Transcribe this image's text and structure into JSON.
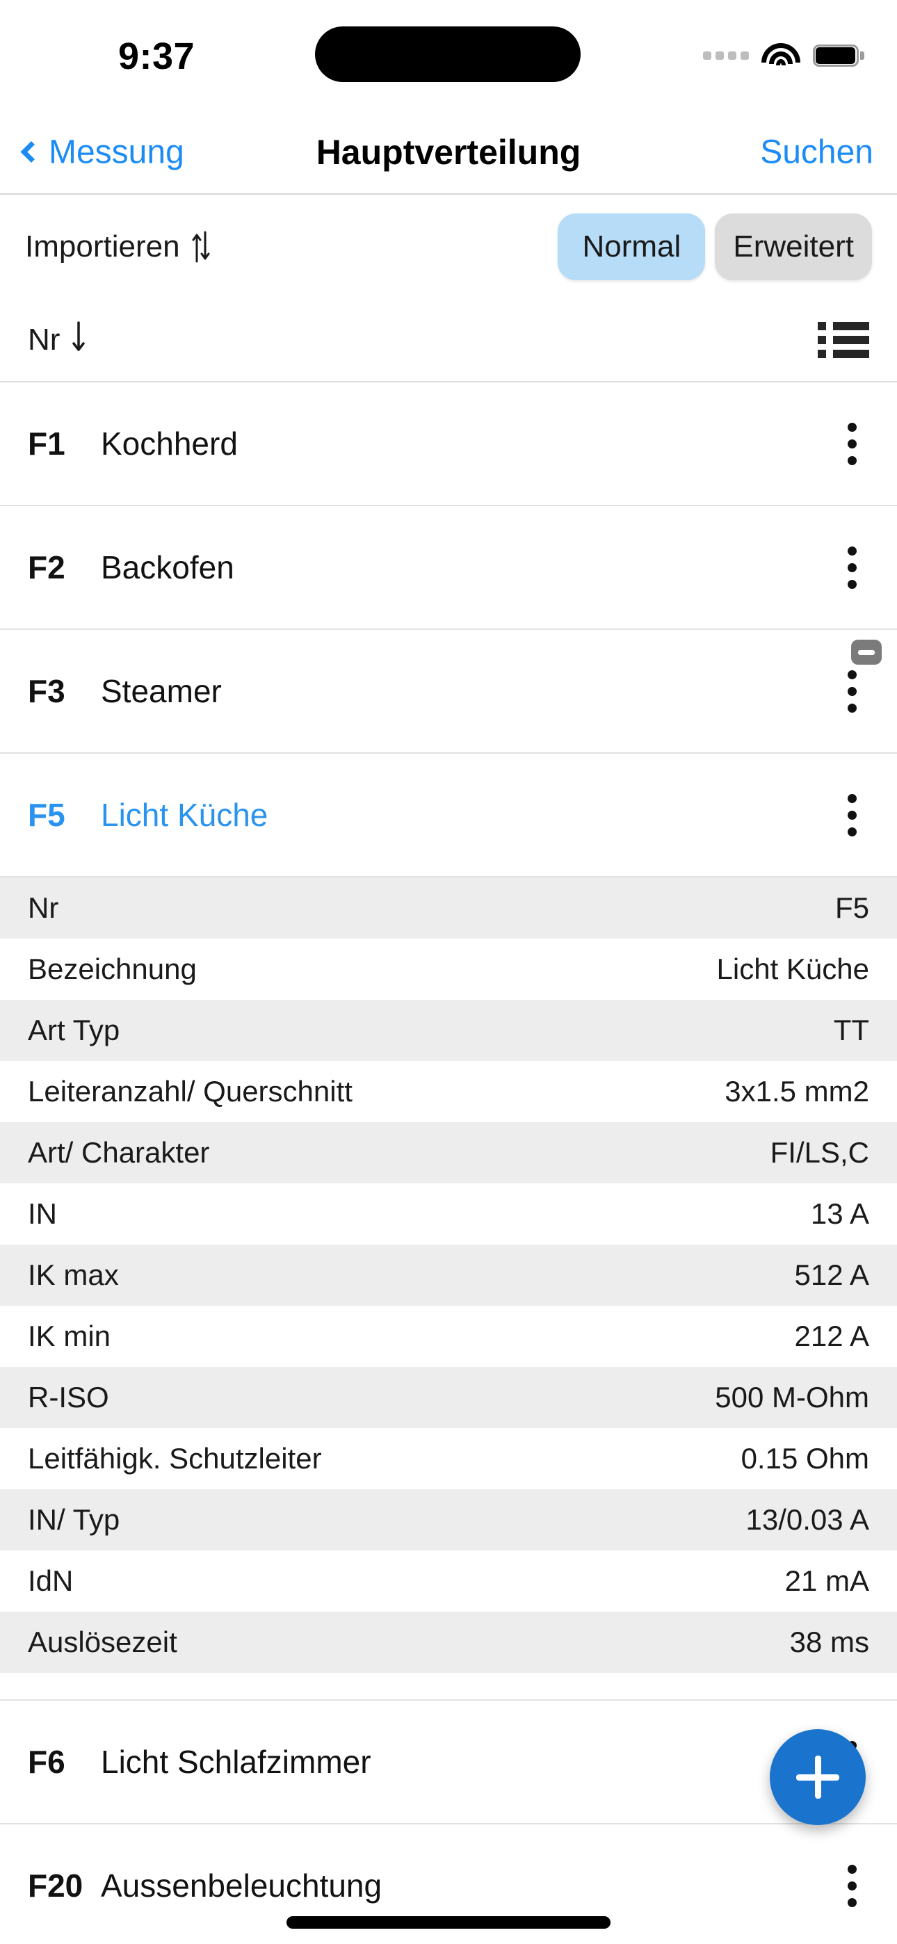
{
  "status_bar": {
    "time": "9:37",
    "icons": [
      "cellular-dots-icon",
      "wifi-icon",
      "battery-icon"
    ]
  },
  "nav_bar": {
    "back_label": "Messung",
    "back_icon": "chevron-left-icon",
    "title": "Hauptverteilung",
    "action_label": "Suchen"
  },
  "toolbar": {
    "import_label": "Importieren",
    "import_icon": "arrows-up-down-icon",
    "segments": [
      {
        "label": "Normal",
        "selected": true
      },
      {
        "label": "Erweitert",
        "selected": false
      }
    ]
  },
  "sort_bar": {
    "label": "Nr",
    "direction_icon": "arrow-down-icon",
    "list_view_icon": "list-bullet-icon"
  },
  "list": {
    "rows": [
      {
        "code": "F1",
        "name": "Kochherd",
        "selected": false,
        "has_minus_badge": false
      },
      {
        "code": "F2",
        "name": "Backofen",
        "selected": false,
        "has_minus_badge": false
      },
      {
        "code": "F3",
        "name": "Steamer",
        "selected": false,
        "has_minus_badge": true
      },
      {
        "code": "F5",
        "name": "Licht Küche",
        "selected": true,
        "has_minus_badge": false
      },
      {
        "code": "F6",
        "name": "Licht Schlafzimmer",
        "selected": false,
        "has_minus_badge": false
      },
      {
        "code": "F20",
        "name": "Aussenbeleuchtung",
        "selected": false,
        "has_minus_badge": false
      }
    ],
    "row_menu_icon": "kebab-menu-icon",
    "minus_badge_icon": "minus-badge-icon"
  },
  "detail_panel": {
    "for_row": "F5",
    "rows": [
      {
        "label": "Nr",
        "value": "F5"
      },
      {
        "label": "Bezeichnung",
        "value": "Licht Küche"
      },
      {
        "label": "Art Typ",
        "value": "TT"
      },
      {
        "label": "Leiteranzahl/ Querschnitt",
        "value": "3x1.5 mm2"
      },
      {
        "label": "Art/ Charakter",
        "value": "FI/LS,C"
      },
      {
        "label": "IN",
        "value": "13 A"
      },
      {
        "label": "IK max",
        "value": "512 A"
      },
      {
        "label": "IK min",
        "value": "212 A"
      },
      {
        "label": "R-ISO",
        "value": "500 M-Ohm"
      },
      {
        "label": "Leitfähigk. Schutzleiter",
        "value": "0.15 Ohm"
      },
      {
        "label": "IN/ Typ",
        "value": "13/0.03 A"
      },
      {
        "label": "IdN",
        "value": "21 mA"
      },
      {
        "label": "Auslösezeit",
        "value": "38 ms"
      }
    ]
  },
  "fab": {
    "icon": "plus-icon",
    "color": "#1a73cc"
  },
  "colors": {
    "accent_blue": "#1c8cf5",
    "fab_blue": "#1a73cc",
    "segment_selected": "#b6dcf7",
    "segment_unselected": "#dcdcdc",
    "detail_alt_row": "#ededed"
  }
}
